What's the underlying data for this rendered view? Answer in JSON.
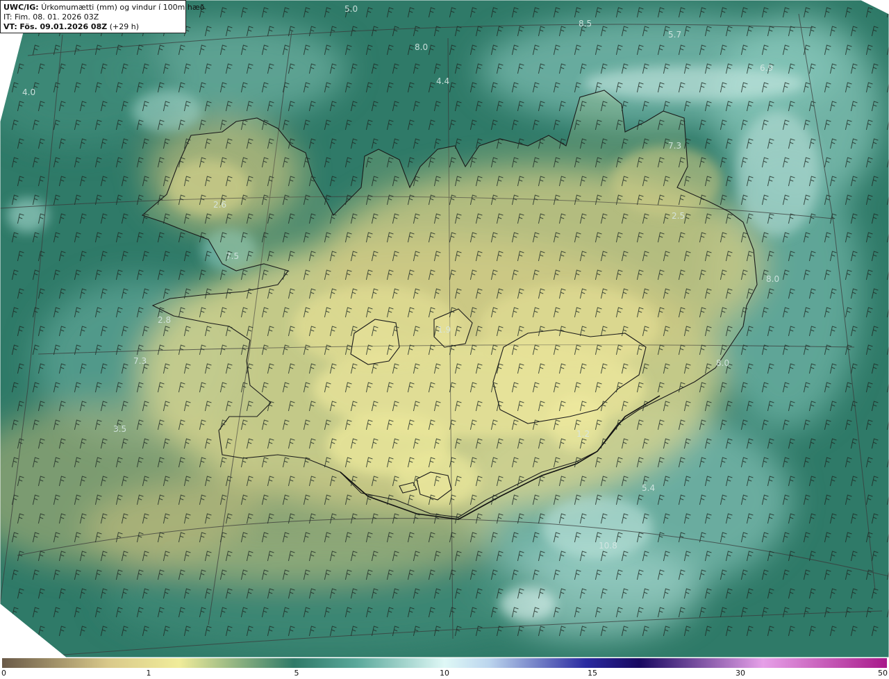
{
  "header": {
    "model": "UWC/IG:",
    "title": "Úrkomumætti (mm) og vindur í 100m hæð",
    "it_prefix": "IT:",
    "it_value": "Fim. 08. 01. 2026 03Z",
    "vt_prefix": "VT:",
    "vt_value": "Fös. 09.01.2026 08Z",
    "vt_offset": "(+29 h)"
  },
  "legend": {
    "ticks": [
      {
        "label": "0",
        "value": 0
      },
      {
        "label": "1",
        "value": 1
      },
      {
        "label": "5",
        "value": 5
      },
      {
        "label": "10",
        "value": 10
      },
      {
        "label": "15",
        "value": 15
      },
      {
        "label": "30",
        "value": 30
      },
      {
        "label": "50",
        "value": 50
      }
    ],
    "colors": [
      "#6a5a48",
      "#d9c98a",
      "#f0ec9a",
      "#2f7a68",
      "#5aa89a",
      "#dff8f6",
      "#bcd6ee",
      "#2a2aa0",
      "#180860",
      "#e6a0e8",
      "#a81a8a"
    ]
  },
  "map_labels": [
    {
      "text": "5.0"
    },
    {
      "text": "8.5"
    },
    {
      "text": "5.7"
    },
    {
      "text": "8.0"
    },
    {
      "text": "4.4"
    },
    {
      "text": "4.0"
    },
    {
      "text": "6.9"
    },
    {
      "text": "7.3"
    },
    {
      "text": "2.5"
    },
    {
      "text": "2.6"
    },
    {
      "text": "7.5"
    },
    {
      "text": "8.0"
    },
    {
      "text": "2.8"
    },
    {
      "text": "7.3"
    },
    {
      "text": "8.0"
    },
    {
      "text": "3.5"
    },
    {
      "text": "1.9"
    },
    {
      "text": "1.2"
    },
    {
      "text": "5.4"
    },
    {
      "text": "10.8"
    }
  ],
  "palette": {
    "land_light": "#e6e09a",
    "land_mid": "#c8c47e",
    "sea": "#2f7a68",
    "sea_light": "#6aa898",
    "high_precip": "#cfeeea",
    "coast": "#1a1a1a",
    "grid": "#3a3a3a",
    "barb": "#1e2a24"
  }
}
